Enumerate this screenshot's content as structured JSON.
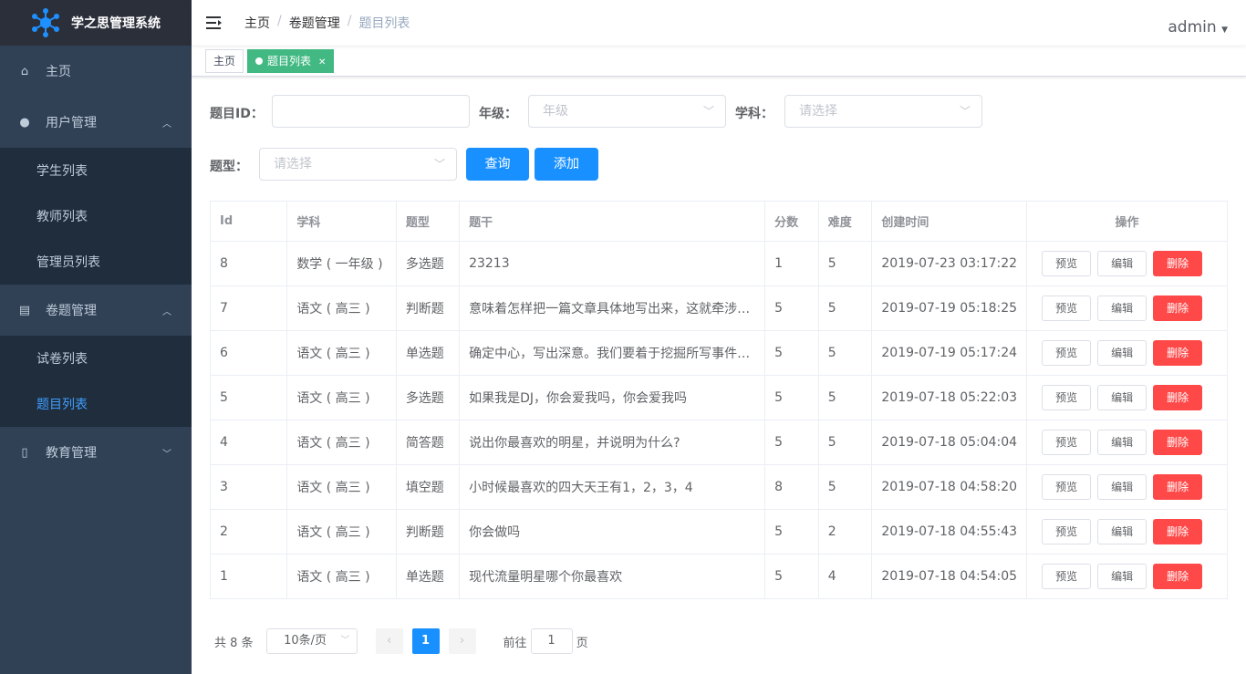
{
  "app": {
    "title": "学之思管理系统",
    "logo_color": "#1e90ff"
  },
  "sidebar": {
    "items": [
      {
        "label": "主页",
        "icon": "home-icon"
      },
      {
        "label": "用户管理",
        "icon": "user-icon",
        "children": [
          "学生列表",
          "教师列表",
          "管理员列表"
        ]
      },
      {
        "label": "卷题管理",
        "icon": "document-icon",
        "children": [
          "试卷列表",
          "题目列表"
        ]
      },
      {
        "label": "教育管理",
        "icon": "book-icon"
      }
    ],
    "active": "题目列表"
  },
  "header": {
    "breadcrumb": [
      "主页",
      "卷题管理",
      "题目列表"
    ],
    "user": "admin"
  },
  "tags": [
    "主页",
    "题目列表"
  ],
  "filters": {
    "id_label": "题目ID：",
    "id_value": "",
    "grade_label": "年级：",
    "grade_placeholder": "年级",
    "subject_label": "学科：",
    "subject_placeholder": "请选择",
    "type_label": "题型：",
    "type_placeholder": "请选择",
    "query": "查询",
    "add": "添加"
  },
  "table": {
    "headers": [
      "Id",
      "学科",
      "题型",
      "题干",
      "分数",
      "难度",
      "创建时间",
      "操作"
    ],
    "rows": [
      [
        "8",
        "数学 ( 一年级 )",
        "多选题",
        "23213",
        "1",
        "5",
        "2019-07-23 03:17:22"
      ],
      [
        "7",
        "语文 ( 高三 )",
        "判断题",
        "意味着怎样把一篇文章具体地写出来，这就牵涉到写作方法",
        "5",
        "5",
        "2019-07-19 05:18:25"
      ],
      [
        "6",
        "语文 ( 高三 )",
        "单选题",
        "确定中心，写出深意。我们要着于挖掘所写事件的深刻意义",
        "5",
        "5",
        "2019-07-19 05:17:24"
      ],
      [
        "5",
        "语文 ( 高三 )",
        "多选题",
        "如果我是DJ，你会爱我吗，你会爱我吗",
        "5",
        "5",
        "2019-07-18 05:22:03"
      ],
      [
        "4",
        "语文 ( 高三 )",
        "简答题",
        "说出你最喜欢的明星，并说明为什么?",
        "5",
        "5",
        "2019-07-18 05:04:04"
      ],
      [
        "3",
        "语文 ( 高三 )",
        "填空题",
        "小时候最喜欢的四大天王有1，2，3，4",
        "8",
        "5",
        "2019-07-18 04:58:20"
      ],
      [
        "2",
        "语文 ( 高三 )",
        "判断题",
        "你会做吗",
        "5",
        "2",
        "2019-07-18 04:55:43"
      ],
      [
        "1",
        "语文 ( 高三 )",
        "单选题",
        "现代流量明星哪个你最喜欢",
        "5",
        "4",
        "2019-07-18 04:54:05"
      ]
    ],
    "actions": [
      "预览",
      "编辑",
      "删除"
    ]
  },
  "pagination": {
    "total": "共 8 条",
    "page_size": "10条/页",
    "current": "1",
    "goto_label": "前往",
    "goto_value": "1",
    "page_suffix": "页"
  }
}
